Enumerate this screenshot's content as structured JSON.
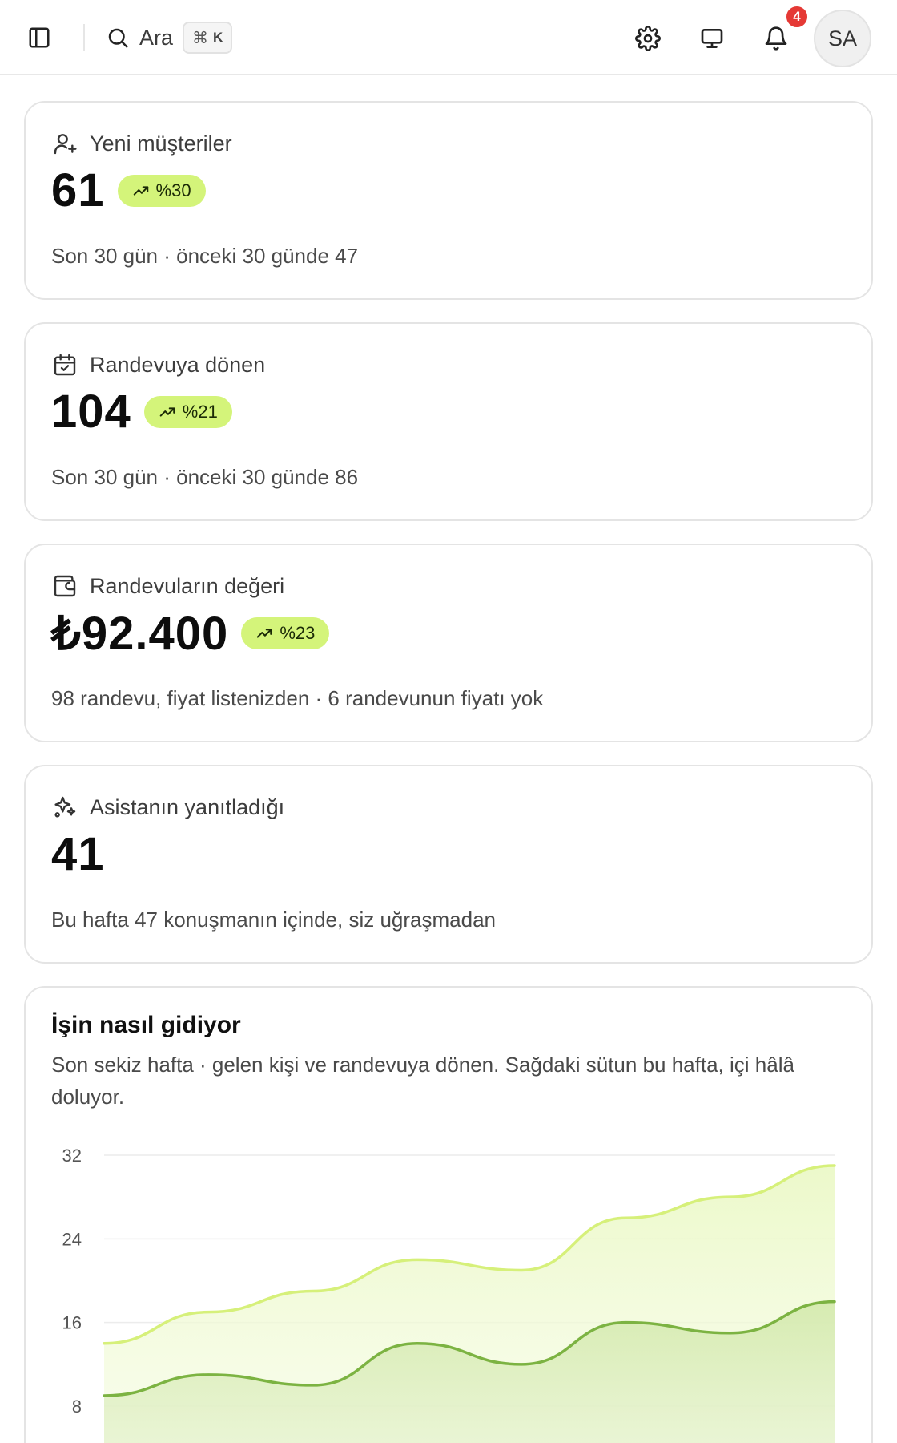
{
  "topbar": {
    "search_label": "Ara",
    "shortcut_symbol": "⌘",
    "shortcut_key": "K",
    "notification_count": "4",
    "avatar_initials": "SA"
  },
  "stats": [
    {
      "icon": "user-plus-icon",
      "title": "Yeni müşteriler",
      "value": "61",
      "change": "%30",
      "subtitle": "Son 30 gün · önceki 30 günde 47"
    },
    {
      "icon": "calendar-check-icon",
      "title": "Randevuya dönen",
      "value": "104",
      "change": "%21",
      "subtitle": "Son 30 gün · önceki 30 günde 86"
    },
    {
      "icon": "wallet-icon",
      "title": "Randevuların değeri",
      "value": "₺92.400",
      "change": "%23",
      "subtitle": "98 randevu, fiyat listenizden · 6 randevunun fiyatı yok"
    },
    {
      "icon": "sparkles-icon",
      "title": "Asistanın yanıtladığı",
      "value": "41",
      "change": "",
      "subtitle": "Bu hafta 47 konuşmanın içinde, siz uğraşmadan"
    }
  ],
  "chart_card": {
    "title": "İşin nasıl gidiyor",
    "description": "Son sekiz hafta · gelen kişi ve randevuya dönen. Sağdaki sütun bu hafta, içi hâlâ doluyor."
  },
  "colors": {
    "accent_light": "#d4f47a",
    "series_incoming": "#d6f07a",
    "series_converted": "#7cb342",
    "badge_red": "#e53935"
  },
  "chart_data": {
    "type": "area",
    "x": [
      1,
      2,
      3,
      4,
      5,
      6,
      7,
      8
    ],
    "y_ticks": [
      8,
      16,
      24,
      32
    ],
    "ylim": [
      0,
      33
    ],
    "grid": true,
    "series": [
      {
        "values": [
          14,
          17,
          19,
          22,
          21,
          26,
          28,
          31
        ]
      },
      {
        "values": [
          9,
          11,
          10,
          14,
          12,
          16,
          15,
          18
        ]
      }
    ]
  }
}
